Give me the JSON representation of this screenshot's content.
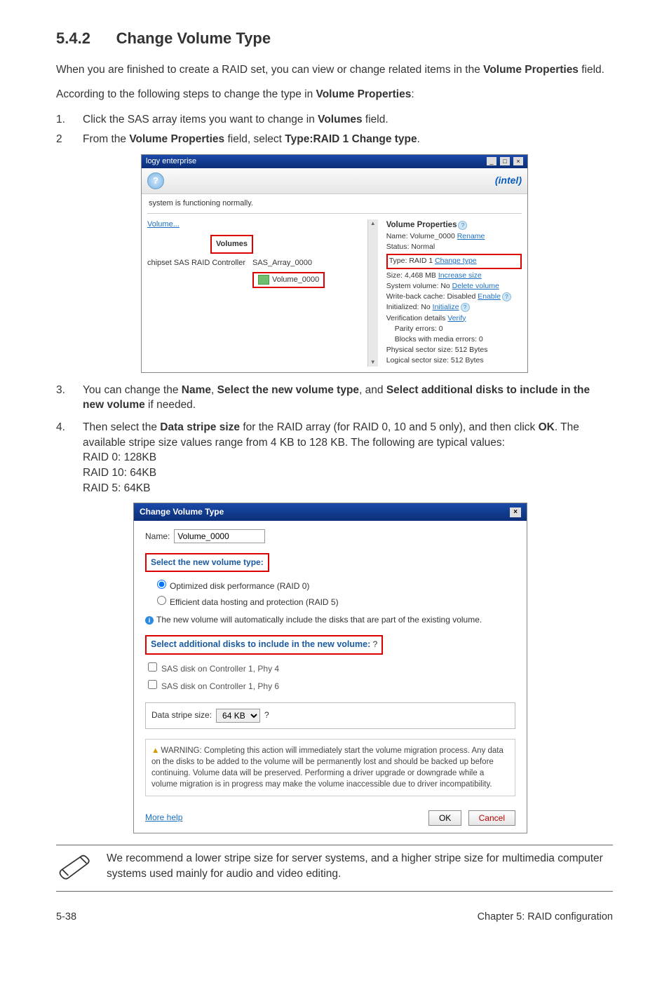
{
  "section": {
    "number": "5.4.2",
    "title": "Change Volume Type"
  },
  "intro1": "When you are finished to create a RAID set, you can view or change related items in the ",
  "intro1b": "Volume Properties",
  "intro1c": " field.",
  "intro2a": "According to the following steps to change the type in ",
  "intro2b": "Volume Properties",
  "intro2c": ":",
  "step1_pre": "Click the SAS array items you want to change in ",
  "step1_bold": "Volumes",
  "step1_post": " field.",
  "step2_pre": "From the ",
  "step2_b1": "Volume Properties",
  "step2_mid": " field, select ",
  "step2_b2": "Type:RAID 1 Change type",
  "step2_post": ".",
  "shot1": {
    "titlebar": "logy enterprise",
    "min": "_",
    "max": "□",
    "close": "×",
    "intel": "intel",
    "status": "system is functioning normally.",
    "volume_link": "Volume...",
    "volumes_label": "Volumes",
    "controller": "chipset SAS RAID Controller",
    "array": "SAS_Array_0000",
    "volume_name": "Volume_0000",
    "props_title": "Volume Properties",
    "name_label": "Name: Volume_0000 ",
    "rename": "Rename",
    "status_label": "Status: Normal",
    "type_label": "Type: RAID 1 ",
    "change_type": "Change type",
    "size_label": "Size: 4,468 MB ",
    "increase_size": "Increase size",
    "sys_vol": "System volume: No ",
    "delete_vol": "Delete volume",
    "wb_cache": "Write-back cache: Disabled ",
    "enable": "Enable",
    "init": "Initialized: No ",
    "initialize": "Initialize",
    "verif": "Verification details ",
    "verify": "Verify",
    "parity": "Parity errors: 0",
    "blocks": "Blocks with media errors: 0",
    "phys": "Physical sector size: 512 Bytes",
    "logical": "Logical sector size: 512 Bytes"
  },
  "step3_pre": "You can change the ",
  "step3_b1": "Name",
  "step3_mid1": ", ",
  "step3_b2": "Select the new volume type",
  "step3_mid2": ", and ",
  "step3_b3": "Select additional disks to include in the new volume",
  "step3_post": " if needed.",
  "step4_pre": "Then select the ",
  "step4_b1": "Data stripe size",
  "step4_mid1": " for the RAID array (for RAID 0, 10 and 5 only), and then click ",
  "step4_b2": "OK",
  "step4_post": ". The available stripe size values range from 4 KB to 128 KB. The following are typical values:",
  "raid_lines": [
    "RAID 0: 128KB",
    "RAID 10: 64KB",
    "RAID 5: 64KB"
  ],
  "shot2": {
    "title": "Change Volume Type",
    "name_label": "Name:",
    "name_value": "Volume_0000",
    "sel_label": "Select the new volume type:",
    "opt1": "Optimized disk performance (RAID 0)",
    "opt2": "Efficient data hosting and protection (RAID 5)",
    "info": "The new volume will automatically include the disks that are part of the existing volume.",
    "add_label": "Select additional disks to include in the new volume:",
    "chk1": "SAS disk on Controller 1, Phy 4",
    "chk2": "SAS disk on Controller 1, Phy 6",
    "stripe_label": "Data stripe size:",
    "stripe_value": "64 KB",
    "warn": "WARNING: Completing this action will immediately start the volume migration process. Any data on the disks to be added to the volume will be permanently lost and should be backed up before continuing. Volume data will be preserved. Performing a driver upgrade or downgrade while a volume migration is in progress may make the volume inaccessible due to driver incompatibility.",
    "more_help": "More help",
    "ok": "OK",
    "cancel": "Cancel"
  },
  "note": "We recommend a lower stripe size for server systems, and a higher stripe size for multimedia computer systems used mainly for audio and video editing.",
  "footer_left": "5-38",
  "footer_right": "Chapter 5: RAID configuration"
}
